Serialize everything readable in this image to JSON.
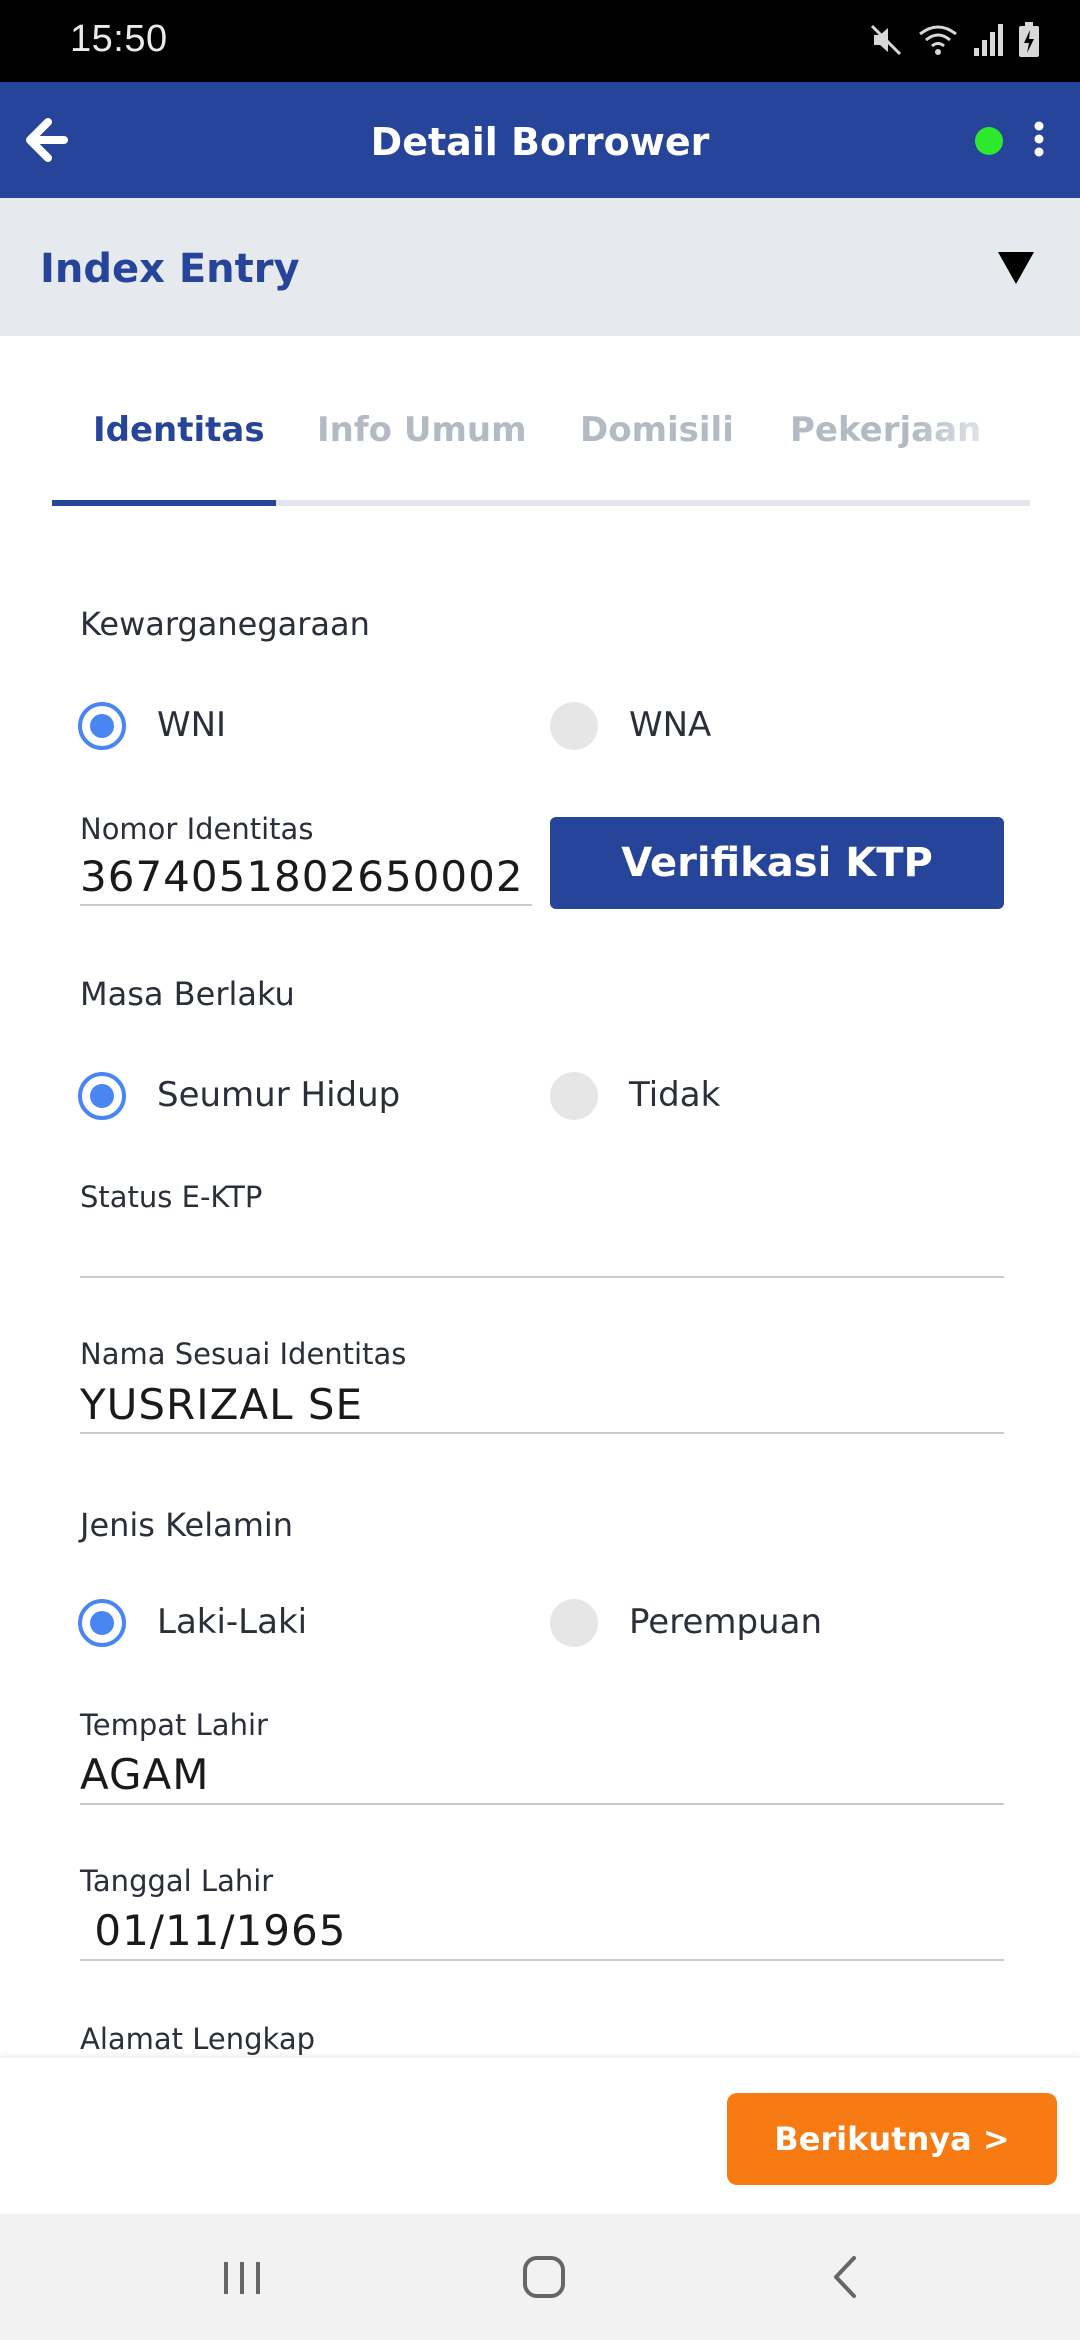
{
  "status_bar": {
    "time": "15:50",
    "icons": [
      "mute-icon",
      "wifi-icon",
      "signal-icon",
      "battery-charging-icon"
    ]
  },
  "header": {
    "title": "Detail Borrower",
    "status_dot_color": "#2ee82e",
    "brand_color": "#26449a"
  },
  "section": {
    "label": "Index Entry"
  },
  "tabs": [
    {
      "label": "Identitas",
      "active": true
    },
    {
      "label": "Info Umum",
      "active": false
    },
    {
      "label": "Domisili",
      "active": false
    },
    {
      "label": "Pekerjaan",
      "active": false
    }
  ],
  "form": {
    "kewarganegaraan": {
      "label": "Kewarganegaraan",
      "options": [
        {
          "label": "WNI",
          "selected": true
        },
        {
          "label": "WNA",
          "selected": false
        }
      ]
    },
    "nomor_identitas": {
      "label": "Nomor Identitas",
      "value": "3674051802650002"
    },
    "verify_button": "Verifikasi KTP",
    "masa_berlaku": {
      "label": "Masa Berlaku",
      "options": [
        {
          "label": "Seumur Hidup",
          "selected": true
        },
        {
          "label": "Tidak",
          "selected": false
        }
      ]
    },
    "status_ektp": {
      "label": "Status E-KTP",
      "value": ""
    },
    "nama": {
      "label": "Nama Sesuai Identitas",
      "value": "YUSRIZAL SE"
    },
    "jenis_kelamin": {
      "label": "Jenis Kelamin",
      "options": [
        {
          "label": "Laki-Laki",
          "selected": true
        },
        {
          "label": "Perempuan",
          "selected": false
        }
      ]
    },
    "tempat_lahir": {
      "label": "Tempat Lahir",
      "value": "AGAM"
    },
    "tanggal_lahir": {
      "label": "Tanggal Lahir",
      "value": " 01/11/1965"
    },
    "alamat": {
      "label": "Alamat Lengkap"
    }
  },
  "actions": {
    "next_label": "Berikutnya >",
    "next_color": "#f77a12"
  },
  "nav": [
    "recent-apps-icon",
    "home-icon",
    "back-icon"
  ]
}
